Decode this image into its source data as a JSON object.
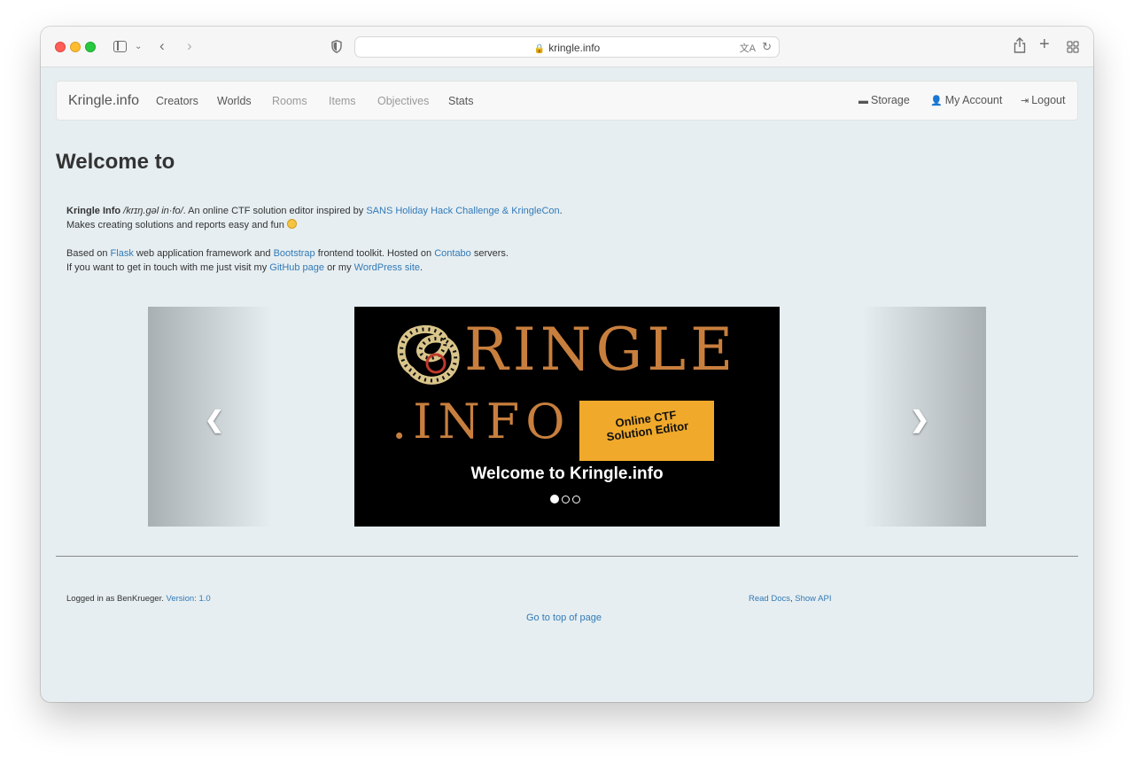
{
  "browser": {
    "url": "kringle.info"
  },
  "navbar": {
    "brand": "Kringle.info",
    "items": [
      {
        "label": "Creators",
        "state": "active"
      },
      {
        "label": "Worlds",
        "state": "active"
      },
      {
        "label": "Rooms",
        "state": "muted"
      },
      {
        "label": "Items",
        "state": "muted"
      },
      {
        "label": "Objectives",
        "state": "muted"
      },
      {
        "label": "Stats",
        "state": "active"
      }
    ],
    "right": {
      "storage": "Storage",
      "account": "My Account",
      "logout": "Logout"
    }
  },
  "page": {
    "title": "Welcome to"
  },
  "intro": {
    "brand": "Kringle Info",
    "pronunciation": "/krɪŋ.ɡəl in·fo/",
    "line1_a": ". An online CTF solution editor inspired by ",
    "challenge_link": "SANS Holiday Hack Challenge & KringleCon",
    "line1_end": ".",
    "line2": "Makes creating solutions and reports easy and fun ",
    "para2_a": "Based on ",
    "flask": "Flask",
    "para2_b": " web application framework and ",
    "bootstrap": "Bootstrap",
    "para2_c": " frontend toolkit. Hosted on ",
    "contabo": "Contabo",
    "para2_d": " servers.",
    "para3_a": "If you want to get in touch with me just visit my ",
    "github": "GitHub page",
    "para3_b": " or my ",
    "wordpress": "WordPress site",
    "para3_c": "."
  },
  "carousel": {
    "logo_word": "RINGLE",
    "logo_suffix": ".INFO",
    "tag_line1": "Online CTF",
    "tag_line2": "Solution Editor",
    "caption": "Welcome to Kringle.info",
    "active_index": 0,
    "slide_count": 3
  },
  "footer": {
    "logged_in": "Logged in as BenKrueger. ",
    "version": "Version: 1.0",
    "read_docs": "Read Docs",
    "separator": ", ",
    "show_api": "Show API",
    "top": "Go to top of page"
  },
  "colors": {
    "link": "#337ab7",
    "logo_orange": "#c87f3e",
    "tag_bg": "#f0a92b",
    "page_bg": "#e6eef1"
  }
}
